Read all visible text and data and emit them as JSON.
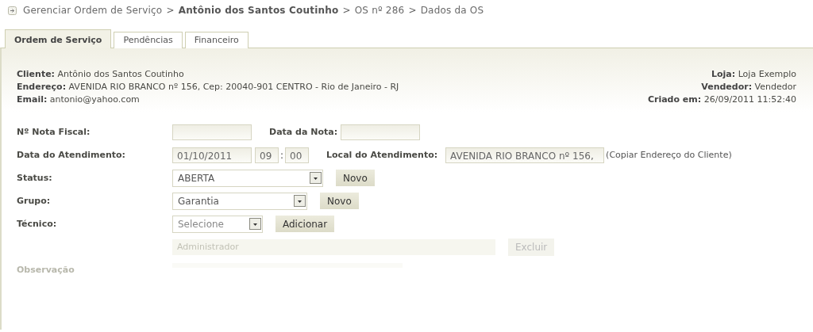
{
  "breadcrumb": {
    "separator": ">",
    "items": [
      {
        "label": "Gerenciar Ordem de Serviço",
        "bold": false
      },
      {
        "label": "Antônio dos Santos Coutinho",
        "bold": true
      },
      {
        "label": "OS nº 286",
        "bold": false
      },
      {
        "label": "Dados da OS",
        "bold": false
      }
    ]
  },
  "tabs": [
    {
      "label": "Ordem de Serviço",
      "selected": true
    },
    {
      "label": "Pendências",
      "selected": false
    },
    {
      "label": "Financeiro",
      "selected": false
    }
  ],
  "info_left": [
    {
      "label": "Cliente:",
      "value": "Antônio dos Santos Coutinho"
    },
    {
      "label": "Endereço:",
      "value": "AVENIDA RIO BRANCO nº 156, Cep: 20040-901 CENTRO - Rio de Janeiro - RJ"
    },
    {
      "label": "Email:",
      "value": "antonio@yahoo.com"
    }
  ],
  "info_right": [
    {
      "label": "Loja:",
      "value": "Loja Exemplo"
    },
    {
      "label": "Vendedor:",
      "value": "Vendedor"
    },
    {
      "label": "Criado em:",
      "value": "26/09/2011 11:52:40"
    }
  ],
  "form": [
    {
      "label": "Nº Nota Fiscal:",
      "faded": false,
      "controls": [
        {
          "kind": "input"
        },
        {
          "kind": "label",
          "text": "Data da Nota:"
        },
        {
          "kind": "input"
        }
      ]
    },
    {
      "label": "Data do Atendimento:",
      "faded": false,
      "controls": [
        {
          "kind": "input",
          "value": "01/10/2011"
        },
        {
          "kind": "input",
          "value": "09"
        },
        {
          "kind": "text",
          "text": ":"
        },
        {
          "kind": "input",
          "value": "00"
        },
        {
          "kind": "label",
          "text": "Local do Atendimento:"
        },
        {
          "kind": "input",
          "value": "AVENIDA RIO BRANCO nº 156,"
        },
        {
          "kind": "link",
          "text": "(Copiar Endereço do Cliente)"
        }
      ]
    },
    {
      "label": "Status:",
      "faded": false,
      "controls": [
        {
          "kind": "select",
          "value": "ABERTA"
        },
        {
          "kind": "button",
          "text": "Novo"
        }
      ]
    },
    {
      "label": "Grupo:",
      "faded": false,
      "controls": [
        {
          "kind": "select",
          "value": "Garantia"
        },
        {
          "kind": "button",
          "text": "Novo"
        }
      ]
    },
    {
      "label": "Técnico:",
      "faded": false,
      "controls": [
        {
          "kind": "select",
          "placeholder": "Selecione"
        },
        {
          "kind": "button",
          "text": "Adicionar"
        }
      ]
    },
    {
      "faded": true,
      "controls": [
        {
          "kind": "item",
          "text": "Administrador"
        },
        {
          "kind": "button",
          "text": "Excluir"
        }
      ]
    },
    {
      "label": "Observação",
      "faded": true,
      "controls": [
        {
          "kind": "area"
        }
      ]
    }
  ]
}
